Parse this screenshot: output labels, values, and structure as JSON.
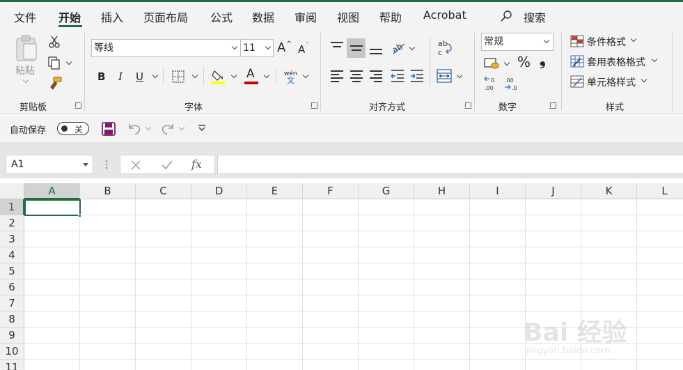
{
  "tabs": [
    "文件",
    "开始",
    "插入",
    "页面布局",
    "公式",
    "数据",
    "审阅",
    "视图",
    "帮助",
    "Acrobat"
  ],
  "search_label": "搜索",
  "clipboard": {
    "paste_label": "粘贴",
    "group_title": "剪贴板"
  },
  "font": {
    "name": "等线",
    "size": "11",
    "group_title": "字体",
    "bold": "B",
    "italic": "I",
    "underline": "U",
    "phonetic_top": "wén",
    "phonetic_bottom": "文",
    "grow": "A",
    "shrink": "A",
    "color_letter": "A"
  },
  "alignment": {
    "group_title": "对齐方式"
  },
  "number": {
    "format": "常规",
    "group_title": "数字",
    "percent": "%",
    "comma": "❟"
  },
  "styles": {
    "conditional": "条件格式",
    "table": "套用表格格式",
    "cell": "单元格样式",
    "group_title": "样式"
  },
  "qat": {
    "autosave_label": "自动保存",
    "toggle_state": "关"
  },
  "formula_bar": {
    "name_box": "A1",
    "fx": "fx"
  },
  "grid": {
    "columns": [
      "A",
      "B",
      "C",
      "D",
      "E",
      "F",
      "G",
      "H",
      "I",
      "J",
      "K",
      "L"
    ],
    "rows": [
      "1",
      "2",
      "3",
      "4",
      "5",
      "6",
      "7",
      "8",
      "9",
      "10",
      "11"
    ],
    "selected_col": "A",
    "selected_row": "1"
  },
  "watermark": {
    "text": "Bai 经验",
    "sub": "jingyan.baidu.com"
  },
  "colors": {
    "accent": "#1e6e42",
    "highlight": "#ffff00",
    "font_red": "#d40000"
  }
}
